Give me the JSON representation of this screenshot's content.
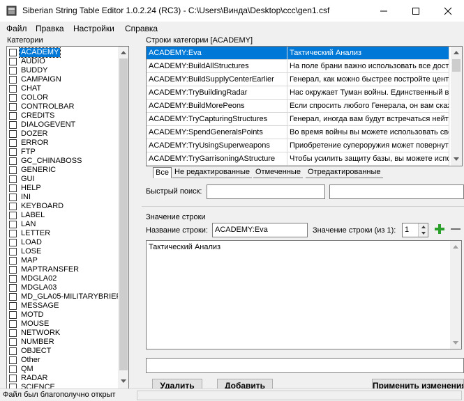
{
  "window": {
    "title": "Siberian String Table Editor 1.0.2.24 (RC3) - C:\\Users\\Винда\\Desktop\\ccc\\gen1.csf"
  },
  "menu": [
    "Файл",
    "Правка",
    "Настройки",
    "Справка"
  ],
  "categories": {
    "label": "Категории",
    "selected": "ACADEMY",
    "items": [
      "ACADEMY",
      "AUDIO",
      "BUDDY",
      "CAMPAIGN",
      "CHAT",
      "COLOR",
      "CONTROLBAR",
      "CREDITS",
      "DIALOGEVENT",
      "DOZER",
      "ERROR",
      "FTP",
      "GC_CHINABOSS",
      "GENERIC",
      "GUI",
      "HELP",
      "INI",
      "KEYBOARD",
      "LABEL",
      "LAN",
      "LETTER",
      "LOAD",
      "LOSE",
      "MAP",
      "MAPTRANSFER",
      "MDGLA02",
      "MDGLA03",
      "MD_GLA05-MILITARYBRIEF",
      "MESSAGE",
      "MOTD",
      "MOUSE",
      "NETWORK",
      "NUMBER",
      "OBJECT",
      "Other",
      "QM",
      "RADAR",
      "SCIENCE"
    ]
  },
  "strings": {
    "label": "Строки категории [ACADEMY]",
    "rows": [
      {
        "name": "ACADEMY:Eva",
        "value": "Тактический Анализ"
      },
      {
        "name": "ACADEMY:BuildAllStructures",
        "value": "На поле брани важно использовать все доступные"
      },
      {
        "name": "ACADEMY:BuildSupplyCenterEarlier",
        "value": "Генерал, как можно быстрее постройте центр снабжения"
      },
      {
        "name": "ACADEMY:TryBuildingRadar",
        "value": "Нас окружает Туман войны. Единственный выход"
      },
      {
        "name": "ACADEMY:BuildMorePeons",
        "value": "Если спросить любого Генерала, он вам скажет"
      },
      {
        "name": "ACADEMY:TryCapturingStructures",
        "value": "Генерал, иногда вам будут встречаться нейтральные"
      },
      {
        "name": "ACADEMY:SpendGeneralsPoints",
        "value": "Во время войны вы можете использовать свои"
      },
      {
        "name": "ACADEMY:TryUsingSuperweapons",
        "value": "Приобретение супероружия может повернуть"
      },
      {
        "name": "ACADEMY:TryGarrisoningAStructure",
        "value": "Чтобы усилить защиту базы, вы можете использовать"
      }
    ]
  },
  "tabs": [
    "Все",
    "Не редактированные",
    "Отмеченные",
    "Отредактированные"
  ],
  "quick_search": {
    "label": "Быстрый поиск:",
    "value1": "",
    "value2": ""
  },
  "string_value": {
    "group_label": "Значение строки",
    "name_label": "Название строки:",
    "name_value": "ACADEMY:Eva",
    "value_label": "Значение строки (из 1):",
    "value_index": "1",
    "text": "Тактический Анализ"
  },
  "buttons": {
    "delete": "Удалить",
    "add": "Добавить",
    "apply": "Применить изменения"
  },
  "status": {
    "text": "Файл был благополучно открыт"
  },
  "colors": {
    "selection": "#0078d7",
    "add_icon": "#2aa02a"
  }
}
